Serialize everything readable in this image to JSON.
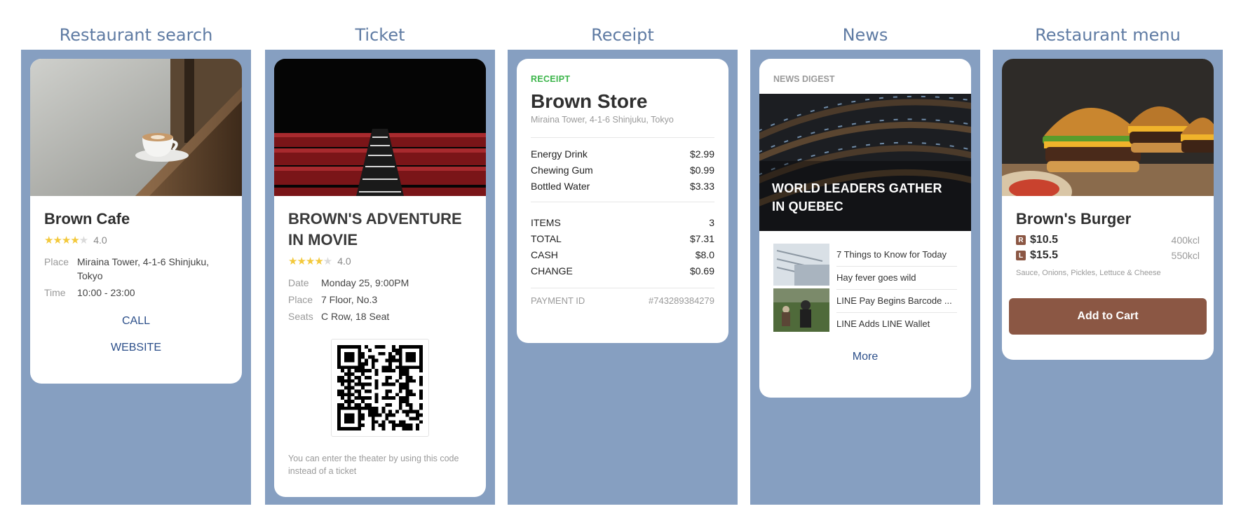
{
  "columns": {
    "restaurant_search": "Restaurant search",
    "ticket": "Ticket",
    "receipt": "Receipt",
    "news": "News",
    "restaurant_menu": "Restaurant menu"
  },
  "colors": {
    "panel": "#869fc1",
    "title": "#5f7ba3",
    "link": "#2c4f8a",
    "accent_green": "#3bb54a",
    "button": "#8b5744",
    "star": "#f3c93c"
  },
  "restaurant": {
    "name": "Brown Cafe",
    "rating": "4.0",
    "rating_value": 4,
    "place_label": "Place",
    "place": "Miraina Tower, 4-1-6 Shinjuku, Tokyo",
    "time_label": "Time",
    "time": "10:00 - 23:00",
    "call_label": "CALL",
    "website_label": "WEBSITE"
  },
  "ticket": {
    "title": "BROWN'S ADVENTURE IN MOVIE",
    "rating": "4.0",
    "rating_value": 4,
    "date_label": "Date",
    "date": "Monday 25, 9:00PM",
    "place_label": "Place",
    "place": "7 Floor, No.3",
    "seats_label": "Seats",
    "seats": "C Row, 18 Seat",
    "note": "You can enter the theater by using this code instead of a ticket"
  },
  "receipt": {
    "label": "RECEIPT",
    "store": "Brown Store",
    "address": "Miraina Tower, 4-1-6 Shinjuku, Tokyo",
    "items": [
      {
        "name": "Energy Drink",
        "price": "$2.99"
      },
      {
        "name": "Chewing Gum",
        "price": "$0.99"
      },
      {
        "name": "Bottled Water",
        "price": "$3.33"
      }
    ],
    "items_label": "ITEMS",
    "items_count": "3",
    "total_label": "TOTAL",
    "total": "$7.31",
    "cash_label": "CASH",
    "cash": "$8.0",
    "change_label": "CHANGE",
    "change": "$0.69",
    "payment_label": "PAYMENT ID",
    "payment_id": "#743289384279"
  },
  "news": {
    "label": "NEWS DIGEST",
    "headline": "WORLD LEADERS GATHER IN QUEBEC",
    "items": [
      "7 Things to Know for Today",
      "Hay fever goes wild",
      "LINE Pay Begins Barcode ...",
      "LINE Adds LINE Wallet"
    ],
    "more_label": "More"
  },
  "menu": {
    "name": "Brown's Burger",
    "sizes": [
      {
        "badge": "R",
        "price": "$10.5",
        "kcal": "400kcl"
      },
      {
        "badge": "L",
        "price": "$15.5",
        "kcal": "550kcl"
      }
    ],
    "ingredients": "Sauce, Onions, Pickles, Lettuce & Cheese",
    "cta": "Add to Cart"
  }
}
